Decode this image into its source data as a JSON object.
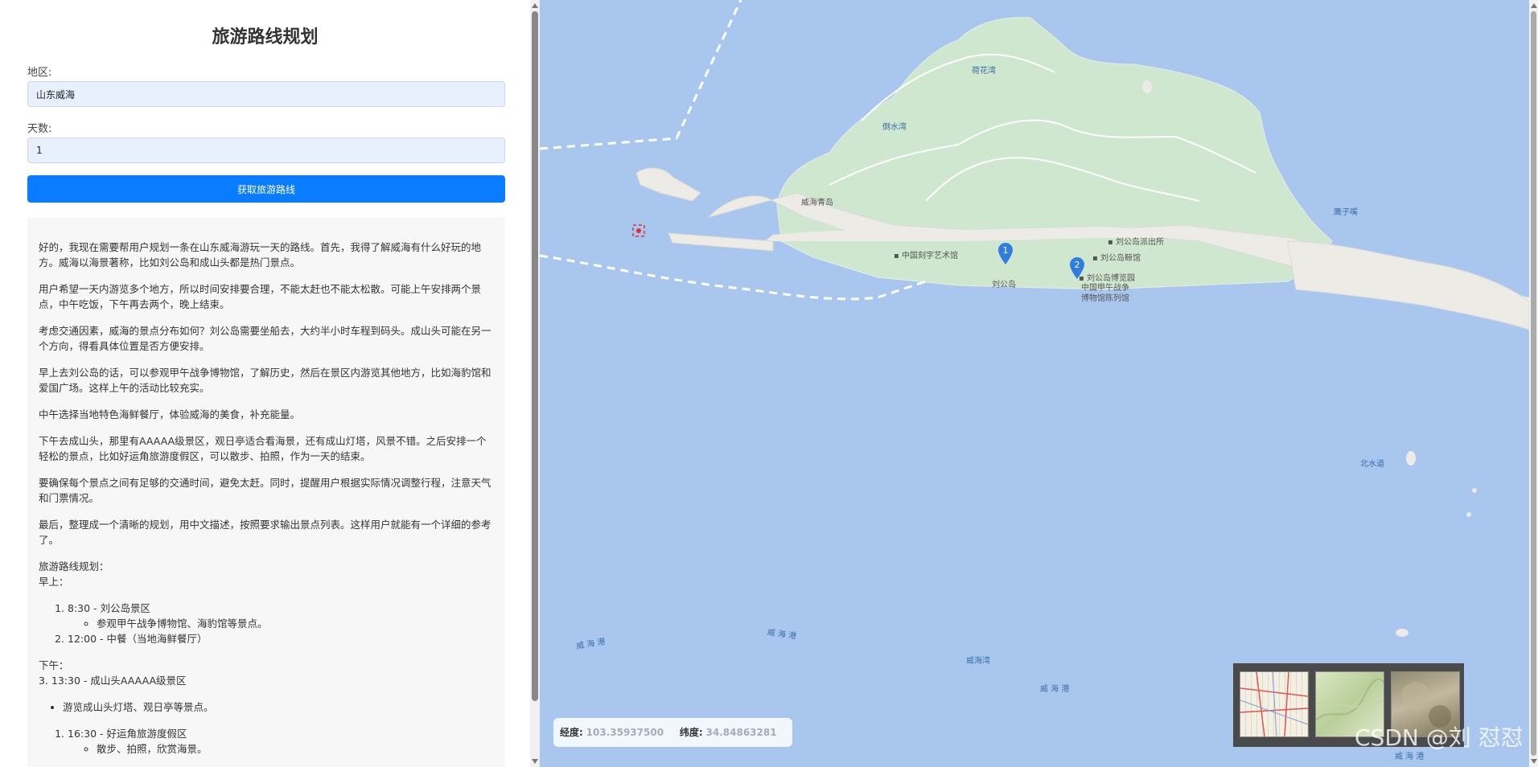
{
  "form": {
    "title": "旅游路线规划",
    "region_label": "地区:",
    "region_value": "山东威海",
    "days_label": "天数:",
    "days_value": "1",
    "submit_label": "获取旅游路线"
  },
  "result": {
    "paragraphs": [
      "好的，我现在需要帮用户规划一条在山东威海游玩一天的路线。首先，我得了解威海有什么好玩的地方。威海以海景著称，比如刘公岛和成山头都是热门景点。",
      "用户希望一天内游览多个地方，所以时间安排要合理，不能太赶也不能太松散。可能上午安排两个景点，中午吃饭，下午再去两个，晚上结束。",
      "考虑交通因素，威海的景点分布如何？刘公岛需要坐船去，大约半小时车程到码头。成山头可能在另一个方向，得看具体位置是否方便安排。",
      "早上去刘公岛的话，可以参观甲午战争博物馆，了解历史，然后在景区内游览其他地方，比如海豹馆和爱国广场。这样上午的活动比较充实。",
      "中午选择当地特色海鲜餐厅，体验威海的美食，补充能量。",
      "下午去成山头，那里有AAAAA级景区，观日亭适合看海景，还有成山灯塔，风景不错。之后安排一个轻松的景点，比如好运角旅游度假区，可以散步、拍照，作为一天的结束。",
      "要确保每个景点之间有足够的交通时间，避免太赶。同时，提醒用户根据实际情况调整行程，注意天气和门票情况。",
      "最后，整理成一个清晰的规划，用中文描述，按照要求输出景点列表。这样用户就能有一个详细的参考了。"
    ],
    "plan_title": "旅游路线规划：",
    "morning_label": "早上：",
    "morning_items": [
      {
        "text": "8:30 - 刘公岛景区",
        "sub": "参观甲午战争博物馆、海豹馆等景点。"
      },
      {
        "text": "12:00 - 中餐（当地海鲜餐厅）",
        "sub": ""
      }
    ],
    "afternoon_label": "下午：",
    "afternoon_line": "3. 13:30 - 成山头AAAAA级景区",
    "afternoon_bullet": "游览成山头灯塔、观日亭等景点。",
    "evening_items": [
      {
        "text": "16:30 - 好运角旅游度假区",
        "sub": "散步、拍照，欣赏海景。"
      }
    ]
  },
  "map": {
    "labels": {
      "hehua_bay": "荷花湾",
      "daoshui_bay": "倒水湾",
      "yingzi_cliff": "鹰子嘴",
      "weihai_qingdao": "威海青岛",
      "carving_museum": "中国刻字艺术馆",
      "police": "刘公岛派出所",
      "liugong_station": "刘公岛",
      "navy_hall": "刘公岛鲸馆",
      "expo_park": "刘公岛博览园",
      "war_museum_1": "中国甲午战争",
      "war_museum_2": "博物馆陈列馆",
      "north_channel": "北水道",
      "weihai_port_1": "威 海 港",
      "weihai_port_2": "威 海 港",
      "weihai_bay": "威海湾",
      "weihai_port_3": "威 海 港",
      "weihai_port_4": "威 海 港"
    },
    "markers": [
      "1",
      "2"
    ],
    "coords": {
      "lng_label": "经度:",
      "lng_value": "103.35937500",
      "lat_label": "纬度:",
      "lat_value": "34.84863281"
    },
    "colors": {
      "sea": "#a9c7ee",
      "land": "#cfe6cf",
      "urban": "#ecebe6",
      "marker": "#2f7de1"
    }
  },
  "watermark": "CSDN @刘 怼怼"
}
